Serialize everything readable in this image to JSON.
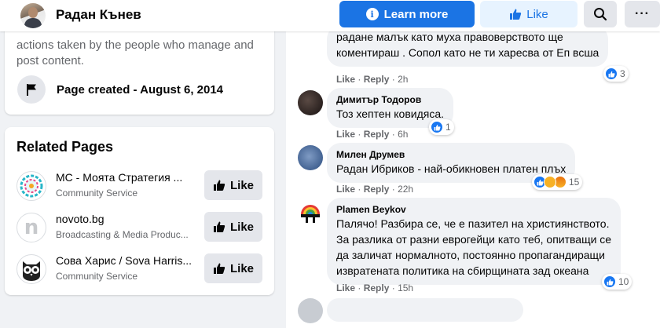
{
  "header": {
    "page_name": "Радан Кънев",
    "learn_more_label": "Learn more",
    "like_label": "Like",
    "more_label": "···"
  },
  "about": {
    "text": "actions taken by the people who manage and post content.",
    "created_label": "Page created - August 6, 2014"
  },
  "related": {
    "title": "Related Pages",
    "items": [
      {
        "name": "МС - Моята Стратегия ...",
        "category": "Community Service",
        "like_label": "Like"
      },
      {
        "name": "novoto.bg",
        "category": "Broadcasting & Media Produc...",
        "like_label": "Like",
        "logo_letter": "n"
      },
      {
        "name": "Сова Харис / Sova Harris...",
        "category": "Community Service",
        "like_label": "Like"
      }
    ]
  },
  "comments": [
    {
      "author": "",
      "text": "радане малък като муха правоверството ще\nкоментираш . Сопол като не ти харесва от Еп всша",
      "like": "Like",
      "reply": "Reply",
      "time": "2h",
      "reactions": "3"
    },
    {
      "author": "Димитър Тодоров",
      "text": "Тоз хептен ковидяса.",
      "like": "Like",
      "reply": "Reply",
      "time": "6h",
      "reactions": "1"
    },
    {
      "author": "Милен Друмев",
      "text": "Радан Ибриков - най-обикновен платен плъх",
      "like": "Like",
      "reply": "Reply",
      "time": "22h",
      "reactions": "15"
    },
    {
      "author": "Plamen Beykov",
      "text": "Палячо! Разбира се, че е пазител на християнството.\nЗа разлика от разни еврогейци като теб, опитващи се\nда заличат нормалното, постоянно пропагандиращи\nизвратената политика на сбирщината зад океана",
      "like": "Like",
      "reply": "Reply",
      "time": "15h",
      "reactions": "10"
    }
  ],
  "separator": "·",
  "colors": {
    "brand_blue": "#1b74e4",
    "like_reaction": "#1877f2",
    "secondary_text": "#65676b",
    "bubble": "#f0f2f5"
  }
}
